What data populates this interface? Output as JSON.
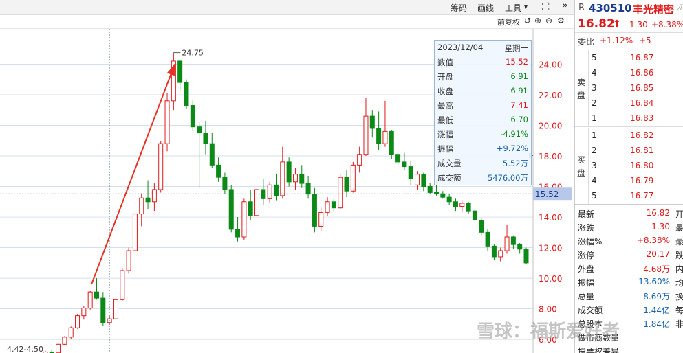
{
  "toolbar": {
    "chip": "筹码",
    "draw": "画线",
    "tools": "工具",
    "tools_arrow": "▾",
    "expand_icon": "⛶",
    "more_icon": "»"
  },
  "subbar": {
    "adjust": "前复权",
    "icons": [
      "↺",
      "⊕",
      "⊖",
      "⚙"
    ]
  },
  "chart": {
    "peak_label": "24.75",
    "low_range_label": "4.42-4.50",
    "crosshair_price": "15.52",
    "y_labels": [
      "24.00",
      "22.00",
      "20.00",
      "18.00",
      "16.00",
      "14.00",
      "12.00",
      "10.00",
      "8.00",
      "6.00"
    ]
  },
  "chart_data": {
    "type": "candlestick",
    "y_label_values": [
      24,
      22,
      20,
      18,
      16,
      14,
      12,
      10,
      8,
      6
    ],
    "ylim": [
      5.2,
      25.5
    ],
    "candles": [
      [
        4.45,
        4.5,
        4.42,
        4.46
      ],
      [
        4.46,
        4.55,
        4.4,
        4.5
      ],
      [
        4.5,
        4.55,
        4.45,
        4.48
      ],
      [
        4.48,
        4.56,
        4.44,
        4.52
      ],
      [
        4.52,
        4.7,
        4.49,
        4.66
      ],
      [
        4.66,
        5.0,
        4.6,
        4.95
      ],
      [
        4.95,
        5.25,
        4.9,
        5.18
      ],
      [
        5.18,
        5.35,
        5.05,
        5.12
      ],
      [
        5.12,
        5.75,
        5.1,
        5.68
      ],
      [
        5.68,
        6.22,
        5.62,
        6.15
      ],
      [
        6.15,
        6.85,
        6.05,
        6.76
      ],
      [
        6.76,
        7.66,
        6.7,
        7.55
      ],
      [
        7.55,
        8.2,
        7.3,
        8.05
      ],
      [
        8.05,
        9.2,
        7.95,
        9.1
      ],
      [
        9.1,
        10.0,
        8.6,
        8.7
      ],
      [
        8.7,
        9.1,
        6.9,
        7.1
      ],
      [
        7.1,
        7.6,
        6.95,
        7.35
      ],
      [
        7.35,
        8.7,
        7.25,
        8.6
      ],
      [
        8.6,
        10.7,
        8.5,
        10.5
      ],
      [
        10.5,
        12.0,
        10.3,
        11.8
      ],
      [
        11.8,
        14.35,
        11.6,
        14.2
      ],
      [
        14.2,
        15.55,
        13.4,
        15.25
      ],
      [
        15.25,
        16.4,
        14.5,
        15.0
      ],
      [
        15.0,
        16.2,
        14.4,
        15.8
      ],
      [
        15.8,
        18.95,
        15.6,
        18.8
      ],
      [
        18.8,
        22.1,
        18.3,
        21.6
      ],
      [
        21.6,
        24.75,
        21.0,
        24.2
      ],
      [
        24.2,
        24.3,
        22.3,
        22.8
      ],
      [
        22.8,
        23.0,
        21.1,
        21.3
      ],
      [
        21.3,
        21.65,
        19.6,
        19.9
      ],
      [
        19.9,
        20.2,
        15.9,
        19.5
      ],
      [
        19.5,
        20.3,
        18.1,
        18.8
      ],
      [
        18.8,
        19.5,
        17.2,
        17.4
      ],
      [
        17.4,
        17.9,
        16.3,
        16.6
      ],
      [
        16.6,
        16.9,
        15.5,
        15.8
      ],
      [
        15.8,
        16.1,
        13.0,
        13.2
      ],
      [
        13.2,
        14.0,
        12.4,
        12.7
      ],
      [
        12.7,
        15.2,
        12.5,
        15.0
      ],
      [
        15.0,
        15.8,
        13.8,
        14.1
      ],
      [
        14.1,
        16.0,
        13.9,
        15.8
      ],
      [
        15.8,
        16.5,
        14.8,
        15.2
      ],
      [
        15.2,
        16.3,
        14.9,
        16.1
      ],
      [
        16.1,
        16.8,
        15.1,
        15.4
      ],
      [
        15.4,
        18.6,
        15.2,
        17.6
      ],
      [
        17.6,
        17.9,
        16.0,
        16.3
      ],
      [
        16.3,
        17.2,
        15.8,
        16.8
      ],
      [
        16.8,
        17.4,
        15.9,
        16.2
      ],
      [
        16.2,
        16.7,
        15.2,
        15.5
      ],
      [
        15.5,
        15.9,
        13.0,
        13.4
      ],
      [
        13.4,
        14.6,
        13.1,
        14.3
      ],
      [
        14.3,
        15.3,
        14.1,
        15.0
      ],
      [
        15.0,
        15.2,
        14.3,
        14.6
      ],
      [
        14.6,
        16.8,
        14.5,
        16.6
      ],
      [
        16.6,
        17.1,
        15.3,
        15.7
      ],
      [
        15.7,
        17.6,
        15.6,
        17.4
      ],
      [
        17.4,
        18.6,
        16.9,
        18.1
      ],
      [
        18.1,
        21.8,
        18.0,
        20.6
      ],
      [
        20.6,
        21.0,
        19.2,
        19.8
      ],
      [
        19.8,
        20.9,
        18.4,
        18.8
      ],
      [
        18.8,
        21.6,
        18.6,
        19.6
      ],
      [
        19.6,
        19.7,
        17.8,
        18.1
      ],
      [
        18.1,
        18.4,
        17.4,
        17.6
      ],
      [
        17.6,
        18.2,
        17.1,
        17.3
      ],
      [
        17.3,
        17.7,
        16.1,
        16.5
      ],
      [
        16.1,
        17.0,
        15.8,
        16.8
      ],
      [
        16.8,
        16.9,
        15.7,
        16.0
      ],
      [
        16.0,
        16.2,
        15.5,
        15.6
      ],
      [
        15.6,
        16.4,
        15.4,
        15.52
      ],
      [
        15.52,
        15.7,
        15.2,
        15.3
      ],
      [
        15.3,
        15.5,
        14.8,
        15.0
      ],
      [
        15.0,
        15.2,
        14.4,
        14.7
      ],
      [
        14.7,
        15.1,
        14.3,
        14.9
      ],
      [
        14.9,
        15.0,
        14.2,
        14.4
      ],
      [
        14.4,
        14.6,
        13.7,
        13.8
      ],
      [
        13.8,
        13.9,
        12.8,
        13.0
      ],
      [
        13.0,
        13.2,
        11.8,
        12.1
      ],
      [
        12.1,
        12.2,
        11.2,
        11.4
      ],
      [
        11.4,
        12.0,
        11.1,
        11.8
      ],
      [
        11.8,
        13.5,
        11.6,
        12.7
      ],
      [
        12.7,
        12.8,
        11.9,
        12.2
      ],
      [
        12.2,
        12.3,
        11.6,
        11.9
      ],
      [
        11.9,
        12.0,
        10.9,
        11.0
      ]
    ]
  },
  "tooltip": {
    "date": "2023/12/04",
    "weekday": "星期一",
    "rows": [
      {
        "label": "数值",
        "value": "15.52",
        "color": "red"
      },
      {
        "label": "开盘",
        "value": "6.91",
        "color": "green"
      },
      {
        "label": "收盘",
        "value": "6.91",
        "color": "green"
      },
      {
        "label": "最高",
        "value": "7.41",
        "color": "red"
      },
      {
        "label": "最低",
        "value": "6.70",
        "color": "green"
      },
      {
        "label": "涨幅",
        "value": "-4.91%",
        "color": "green"
      },
      {
        "label": "振幅",
        "value": "+9.72%",
        "color": "blue"
      },
      {
        "label": "成交量",
        "value": "5.52万",
        "color": "blue"
      },
      {
        "label": "成交额",
        "value": "5476.00万",
        "color": "blue"
      }
    ]
  },
  "quote": {
    "prefix": "R",
    "code": "430510",
    "name": "丰光精密",
    "trail": "⁄/",
    "price": "16.82",
    "arrow": "⬆",
    "change": "1.30",
    "change_pct": "+8.38%",
    "ratio_label": "委比",
    "ratio_pct": "+1.12%",
    "ratio_diff": "+5",
    "sell_label": "卖盘",
    "buy_label": "买盘",
    "sell": [
      {
        "lvl": "5",
        "price": "16.87"
      },
      {
        "lvl": "4",
        "price": "16.86"
      },
      {
        "lvl": "3",
        "price": "16.85"
      },
      {
        "lvl": "2",
        "price": "16.84"
      },
      {
        "lvl": "1",
        "price": "16.83"
      }
    ],
    "buy": [
      {
        "lvl": "1",
        "price": "16.82"
      },
      {
        "lvl": "2",
        "price": "16.81"
      },
      {
        "lvl": "3",
        "price": "16.80"
      },
      {
        "lvl": "4",
        "price": "16.79"
      },
      {
        "lvl": "5",
        "price": "16.77"
      }
    ],
    "stats": [
      {
        "label": "最新",
        "value": "16.82",
        "suffix": "开",
        "vcolor": "red"
      },
      {
        "label": "涨跌",
        "value": "1.30",
        "suffix": "最",
        "vcolor": "red"
      },
      {
        "label": "涨幅%",
        "value": "+8.38%",
        "suffix": "最",
        "vcolor": "red"
      },
      {
        "label": "涨停",
        "value": "20.17",
        "suffix": "跌",
        "vcolor": "red"
      },
      {
        "label": "外盘",
        "value": "4.68万",
        "suffix": "内",
        "vcolor": "red"
      },
      {
        "label": "振幅",
        "value": "13.60%",
        "suffix": "均",
        "vcolor": "blue"
      },
      {
        "label": "总量",
        "value": "8.69万",
        "suffix": "换",
        "vcolor": "blue"
      },
      {
        "label": "成交额",
        "value": "1.44亿",
        "suffix": "每",
        "vcolor": "blue"
      },
      {
        "label": "总股本",
        "value": "1.84亿",
        "suffix": "非",
        "vcolor": "blue"
      },
      {
        "label": "做市商数量",
        "value": "",
        "suffix": "",
        "vcolor": "blue"
      },
      {
        "label": "投票权差异",
        "value": "",
        "suffix": "",
        "vcolor": "blue"
      }
    ]
  },
  "watermark": "雪球：福斯爱好者",
  "colors": {
    "up": "#e0191b",
    "down": "#0b8a17",
    "grid": "#c8d4e6",
    "arrow": "#e53222"
  }
}
